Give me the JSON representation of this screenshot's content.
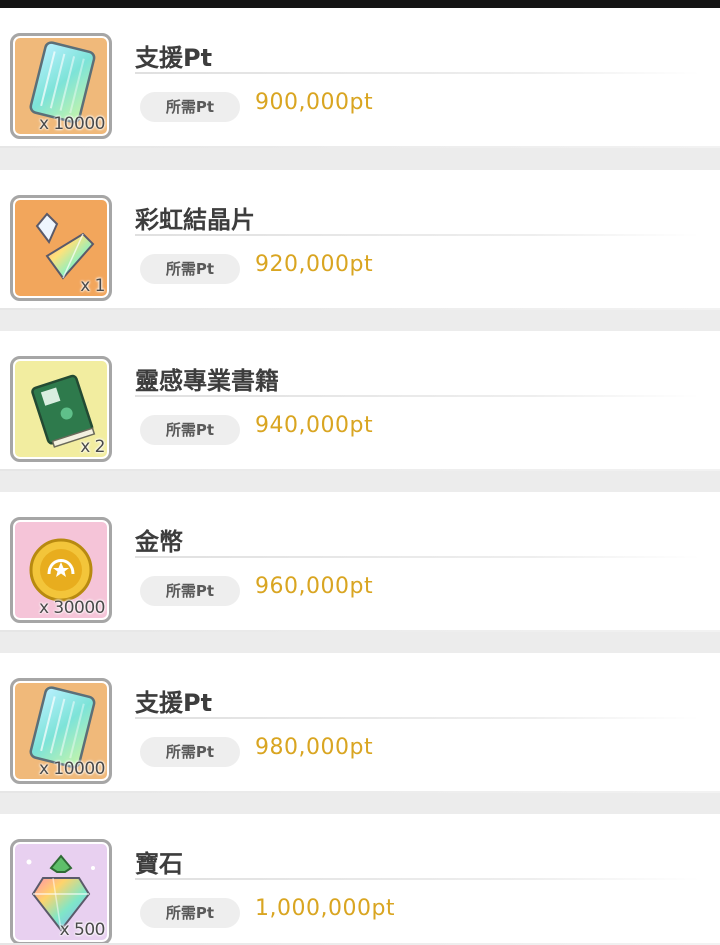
{
  "required_pt_label": "所需Pt",
  "rewards": [
    {
      "name": "支援Pt",
      "quantity": "x 10000",
      "cost": "900,000pt",
      "icon": "support-pt-ticket-icon",
      "frame_color": "#f0b97a"
    },
    {
      "name": "彩虹結晶片",
      "quantity": "x 1",
      "cost": "920,000pt",
      "icon": "rainbow-crystal-shard-icon",
      "frame_color": "#f2a65c"
    },
    {
      "name": "靈感專業書籍",
      "quantity": "x 2",
      "cost": "940,000pt",
      "icon": "inspiration-book-icon",
      "frame_color": "#f2eda0"
    },
    {
      "name": "金幣",
      "quantity": "x 30000",
      "cost": "960,000pt",
      "icon": "gold-coin-icon",
      "frame_color": "#f5c4d8"
    },
    {
      "name": "支援Pt",
      "quantity": "x 10000",
      "cost": "980,000pt",
      "icon": "support-pt-ticket-icon",
      "frame_color": "#f0b97a"
    },
    {
      "name": "寶石",
      "quantity": "x 500",
      "cost": "1,000,000pt",
      "icon": "rainbow-gem-icon",
      "frame_color": "#e8d0f0"
    }
  ]
}
